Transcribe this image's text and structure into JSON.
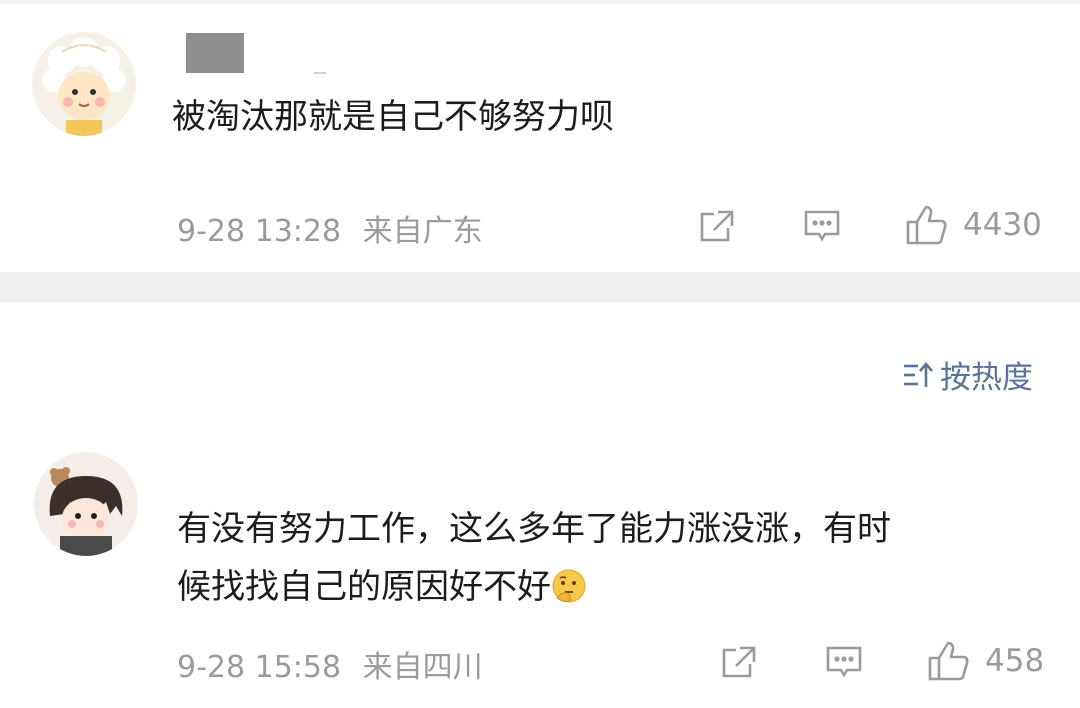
{
  "comments": [
    {
      "text": "被淘汰那就是自己不够努力呗",
      "time": "9-28 13:28",
      "location": "来自广东",
      "likes": "4430"
    },
    {
      "text_line1": "有没有努力工作，这么多年了能力涨没涨，有时",
      "text_line2": "候找找自己的原因好不好",
      "emoji": "thinking-face-emoji",
      "time": "9-28 15:58",
      "location": "来自四川",
      "likes": "458"
    }
  ],
  "sort": {
    "label": "按热度"
  },
  "icons": [
    "share-icon",
    "comment-icon",
    "like-icon",
    "sort-icon"
  ],
  "colors": {
    "meta": "#9b9b9b",
    "sort_accent": "#5b7399",
    "divider": "#efefef"
  }
}
